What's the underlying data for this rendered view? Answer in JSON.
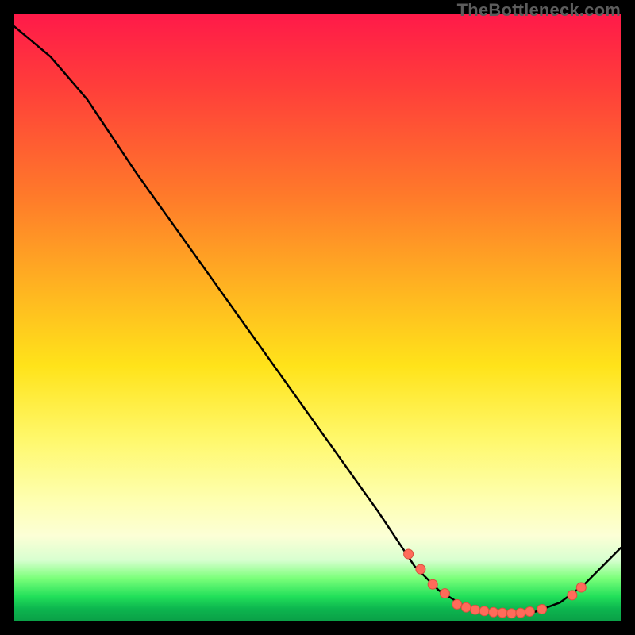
{
  "watermark": "TheBottleneck.com",
  "colors": {
    "curve_stroke": "#000000",
    "marker_fill": "#ff6b5a",
    "marker_stroke": "#d9503f"
  },
  "chart_data": {
    "type": "line",
    "title": "",
    "xlabel": "",
    "ylabel": "",
    "xlim": [
      0,
      100
    ],
    "ylim": [
      0,
      100
    ],
    "curve": [
      {
        "x": 0,
        "y": 98
      },
      {
        "x": 6,
        "y": 93
      },
      {
        "x": 12,
        "y": 86
      },
      {
        "x": 20,
        "y": 74
      },
      {
        "x": 30,
        "y": 60
      },
      {
        "x": 40,
        "y": 46
      },
      {
        "x": 50,
        "y": 32
      },
      {
        "x": 60,
        "y": 18
      },
      {
        "x": 66,
        "y": 9
      },
      {
        "x": 70,
        "y": 5
      },
      {
        "x": 74,
        "y": 2.5
      },
      {
        "x": 78,
        "y": 1.5
      },
      {
        "x": 82,
        "y": 1.2
      },
      {
        "x": 86,
        "y": 1.5
      },
      {
        "x": 90,
        "y": 3
      },
      {
        "x": 94,
        "y": 6
      },
      {
        "x": 98,
        "y": 10
      },
      {
        "x": 100,
        "y": 12
      }
    ],
    "markers": [
      {
        "x": 65,
        "y": 11
      },
      {
        "x": 67,
        "y": 8.5
      },
      {
        "x": 69,
        "y": 6
      },
      {
        "x": 71,
        "y": 4.5
      },
      {
        "x": 73,
        "y": 2.7
      },
      {
        "x": 74.5,
        "y": 2.2
      },
      {
        "x": 76,
        "y": 1.8
      },
      {
        "x": 77.5,
        "y": 1.6
      },
      {
        "x": 79,
        "y": 1.4
      },
      {
        "x": 80.5,
        "y": 1.3
      },
      {
        "x": 82,
        "y": 1.2
      },
      {
        "x": 83.5,
        "y": 1.3
      },
      {
        "x": 85,
        "y": 1.5
      },
      {
        "x": 87,
        "y": 1.9
      },
      {
        "x": 92,
        "y": 4.2
      },
      {
        "x": 93.5,
        "y": 5.5
      }
    ]
  }
}
